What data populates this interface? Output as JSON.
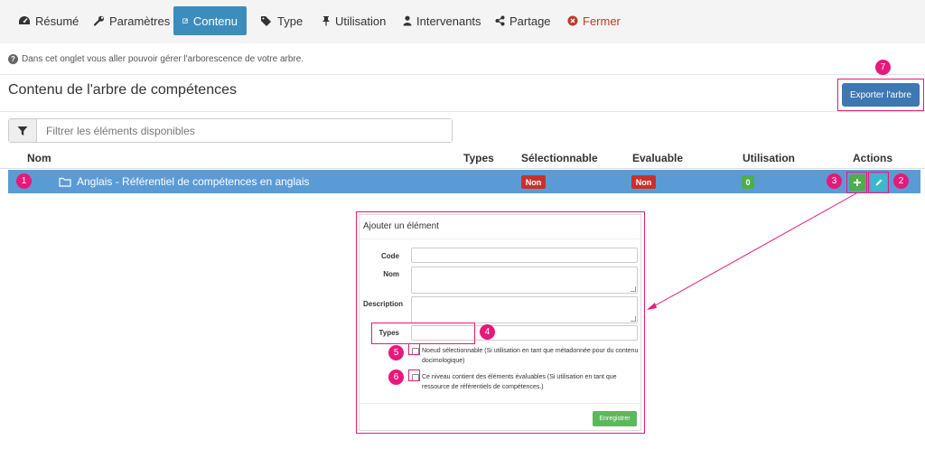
{
  "tabs": [
    {
      "label": "Résumé",
      "icon": "dashboard-icon"
    },
    {
      "label": "Paramètres",
      "icon": "wrench-icon"
    },
    {
      "label": "Contenu",
      "icon": "edit-icon",
      "active": true
    },
    {
      "label": "Type",
      "icon": "tags-icon"
    },
    {
      "label": "Utilisation",
      "icon": "pushpin-icon"
    },
    {
      "label": "Intervenants",
      "icon": "user-icon"
    },
    {
      "label": "Partage",
      "icon": "share-icon"
    },
    {
      "label": "Fermer",
      "icon": "close-circle-icon",
      "color": "#c0392b"
    }
  ],
  "help_text": "Dans cet onglet vous aller pouvoir gérer l'arborescence de votre arbre.",
  "page_title": "Contenu de l'arbre de compétences",
  "export_label": "Exporter l'arbre",
  "filter_placeholder": "Filtrer les éléments disponibles",
  "columns": {
    "nom": "Nom",
    "types": "Types",
    "selectionnable": "Sélectionnable",
    "evaluable": "Evaluable",
    "utilisation": "Utilisation",
    "actions": "Actions"
  },
  "row": {
    "label": "Anglais - Référentiel de compétences en anglais",
    "selectionnable": "Non",
    "evaluable": "Non",
    "utilisation": "0"
  },
  "panel": {
    "title": "Ajouter un élément",
    "code_label": "Code",
    "nom_label": "Nom",
    "description_label": "Description",
    "types_label": "Types",
    "checkbox1": "Noeud sélectionnable (Si utilisation en tant que métadonnée pour du contenu docimologique)",
    "checkbox2": "Ce niveau contient des éléments évaluables (Si utilisation en tant que ressource de référentiels de compétences.)",
    "save_label": "Enregistrer"
  },
  "badges": [
    "1",
    "2",
    "3",
    "4",
    "5",
    "6",
    "7"
  ],
  "colors": {
    "accent": "#3c8dbc",
    "row": "#5b9bd5",
    "annotation": "#e6197a",
    "danger": "#c9302c",
    "success": "#4cae4c"
  }
}
